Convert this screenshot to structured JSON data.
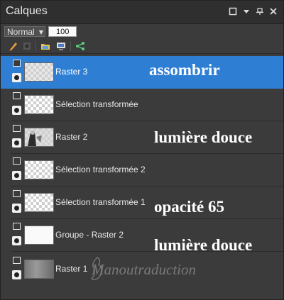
{
  "panel": {
    "title": "Calques",
    "titlebar_icons": [
      "maximize-icon",
      "dropdown-arrow-icon",
      "pin-icon",
      "close-icon"
    ]
  },
  "blend": {
    "mode": "Normal",
    "opacity": "100"
  },
  "toolbar": {
    "tools": [
      "brush-icon",
      "mask-icon",
      "folder-icon",
      "layer-props-icon",
      "share-icon"
    ]
  },
  "layers": [
    {
      "name": "Raster 3",
      "selected": true,
      "thumbnail": "checkerboard"
    },
    {
      "name": "Sélection transformée",
      "selected": false,
      "thumbnail": "checkerboard"
    },
    {
      "name": "Raster 2",
      "selected": false,
      "thumbnail": "image"
    },
    {
      "name": "Sélection transformée 2",
      "selected": false,
      "thumbnail": "checkerboard"
    },
    {
      "name": "Sélection transformée 1",
      "selected": false,
      "thumbnail": "checkerboard"
    },
    {
      "name": "Groupe - Raster 2",
      "selected": false,
      "thumbnail": "white"
    },
    {
      "name": "Raster 1",
      "selected": false,
      "thumbnail": "gray"
    }
  ],
  "annotations": {
    "raster3": "assombrir",
    "raster2": "lumière douce",
    "selection1": "opacité 65",
    "groupe": "lumière douce"
  },
  "watermark": "Manoutraduction",
  "colors": {
    "selected": "#2e7fd4",
    "panel_bg": "#3b3b3b"
  }
}
